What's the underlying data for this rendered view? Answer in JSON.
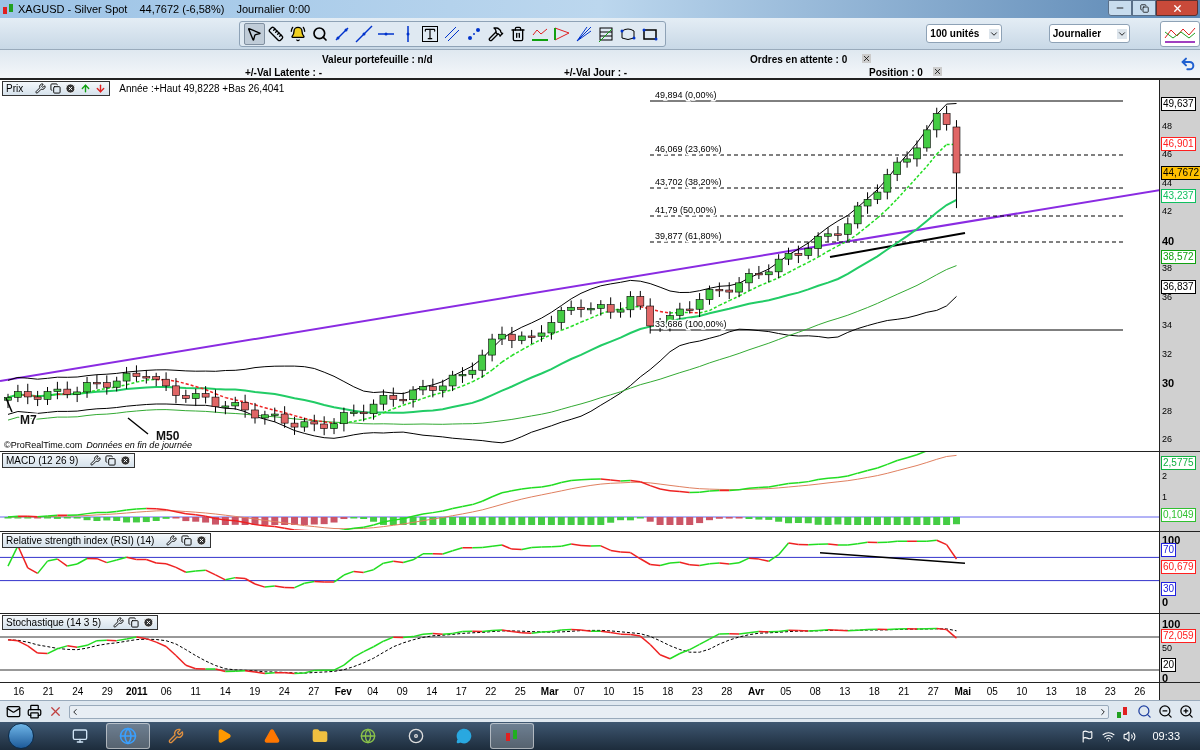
{
  "window": {
    "title": "XAGUSD - Silver Spot",
    "quote": "44,7672 (-6,58%)",
    "period": "Journalier",
    "time": "0:00"
  },
  "toolbar": {
    "tools": [
      {
        "kind": "pointer",
        "selected": true
      },
      {
        "kind": "ruler",
        "selected": false
      },
      {
        "kind": "alarm",
        "selected": false
      },
      {
        "kind": "zoom",
        "selected": false
      },
      {
        "kind": "segment",
        "selected": false
      },
      {
        "kind": "ray",
        "selected": false
      },
      {
        "kind": "hline",
        "selected": false
      },
      {
        "kind": "vline",
        "selected": false
      },
      {
        "kind": "text",
        "selected": false
      },
      {
        "kind": "parallel",
        "selected": false
      },
      {
        "kind": "points",
        "selected": false
      },
      {
        "kind": "tools",
        "selected": false
      },
      {
        "kind": "trash",
        "selected": false
      },
      {
        "kind": "fibonacci",
        "selected": false
      },
      {
        "kind": "fan",
        "selected": false
      },
      {
        "kind": "gann",
        "selected": false
      },
      {
        "kind": "grid",
        "selected": false
      },
      {
        "kind": "channel",
        "selected": false
      },
      {
        "kind": "rectangle",
        "selected": false
      }
    ],
    "quantity": "100 unités",
    "timeframe": "Journalier"
  },
  "portfolio": {
    "value": "Valeur portefeuille : n/d",
    "pending": "Ordres en attente : 0",
    "latent": "+/-Val Latente : -",
    "day": "+/-Val Jour : -",
    "position": "Position : 0"
  },
  "panes": [
    {
      "kind": "price",
      "title": "Prix",
      "info": "Année :+Haut 49,8228 +Bas 26,4041",
      "yticks": [
        {
          "label": "48",
          "bold": false
        },
        {
          "label": "46",
          "bold": false
        },
        {
          "label": "44",
          "bold": false
        },
        {
          "label": "42",
          "bold": false
        },
        {
          "label": "40",
          "bold": true
        },
        {
          "label": "38",
          "bold": false
        },
        {
          "label": "36",
          "bold": false
        },
        {
          "label": "34",
          "bold": false
        },
        {
          "label": "32",
          "bold": false
        },
        {
          "label": "30",
          "bold": true
        },
        {
          "label": "28",
          "bold": false
        },
        {
          "label": "26",
          "bold": false
        }
      ],
      "badges": [
        {
          "text": "49,637",
          "color": "#000000",
          "highlighted": false
        },
        {
          "text": "46,901",
          "color": "#ff2020",
          "highlighted": false
        },
        {
          "text": "44,7672",
          "color": "#000000",
          "highlighted": true
        },
        {
          "text": "43,237",
          "color": "#10c060",
          "highlighted": false
        },
        {
          "text": "38,572",
          "color": "#10a010",
          "highlighted": false
        },
        {
          "text": "36,837",
          "color": "#000000",
          "highlighted": false
        }
      ],
      "fib_levels": [
        "49,894 (0,00%)",
        "46,069 (23,60%)",
        "43,702 (38,20%)",
        "41,79 (50,00%)",
        "39,877 (61,80%)",
        "33,686 (100,00%)"
      ],
      "annotations": [
        "M7",
        "M50"
      ],
      "credit": "©ProRealTime.com",
      "credit_note": "Données en fin de journée"
    },
    {
      "kind": "macd",
      "title": "MACD (12 26 9)",
      "yticks": [
        {
          "label": "2",
          "bold": false
        },
        {
          "label": "1",
          "bold": false
        }
      ],
      "badges": [
        {
          "text": "2,5775",
          "color": "#10b040",
          "highlighted": false
        },
        {
          "text": "0,1049",
          "color": "#30c030",
          "highlighted": false
        }
      ]
    },
    {
      "kind": "rsi",
      "title": "Relative strength index (RSI) (14)",
      "yticks": [
        {
          "label": "100",
          "bold": true
        },
        {
          "label": "0",
          "bold": true
        }
      ],
      "badges": [
        {
          "text": "70",
          "color": "#2020e0",
          "highlighted": false
        },
        {
          "text": "60,679",
          "color": "#ff2020",
          "highlighted": false
        },
        {
          "text": "30",
          "color": "#2020e0",
          "highlighted": false
        }
      ]
    },
    {
      "kind": "stochastic",
      "title": "Stochastique (14 3 5)",
      "yticks": [
        {
          "label": "100",
          "bold": true
        },
        {
          "label": "50",
          "bold": false
        },
        {
          "label": "0",
          "bold": true
        }
      ],
      "badges": [
        {
          "text": "72,059",
          "color": "#ff2020",
          "highlighted": false
        },
        {
          "text": "20",
          "color": "#000000",
          "highlighted": false
        }
      ]
    }
  ],
  "date_axis": [
    {
      "label": "16",
      "bold": false
    },
    {
      "label": "21",
      "bold": false
    },
    {
      "label": "24",
      "bold": false
    },
    {
      "label": "29",
      "bold": false
    },
    {
      "label": "2011",
      "bold": true
    },
    {
      "label": "06",
      "bold": false
    },
    {
      "label": "11",
      "bold": false
    },
    {
      "label": "14",
      "bold": false
    },
    {
      "label": "19",
      "bold": false
    },
    {
      "label": "24",
      "bold": false
    },
    {
      "label": "27",
      "bold": false
    },
    {
      "label": "Fev",
      "bold": true
    },
    {
      "label": "04",
      "bold": false
    },
    {
      "label": "09",
      "bold": false
    },
    {
      "label": "14",
      "bold": false
    },
    {
      "label": "17",
      "bold": false
    },
    {
      "label": "22",
      "bold": false
    },
    {
      "label": "25",
      "bold": false
    },
    {
      "label": "Mar",
      "bold": true
    },
    {
      "label": "07",
      "bold": false
    },
    {
      "label": "10",
      "bold": false
    },
    {
      "label": "15",
      "bold": false
    },
    {
      "label": "18",
      "bold": false
    },
    {
      "label": "23",
      "bold": false
    },
    {
      "label": "28",
      "bold": false
    },
    {
      "label": "Avr",
      "bold": true
    },
    {
      "label": "05",
      "bold": false
    },
    {
      "label": "08",
      "bold": false
    },
    {
      "label": "13",
      "bold": false
    },
    {
      "label": "18",
      "bold": false
    },
    {
      "label": "21",
      "bold": false
    },
    {
      "label": "27",
      "bold": false
    },
    {
      "label": "Mai",
      "bold": true
    },
    {
      "label": "05",
      "bold": false
    },
    {
      "label": "10",
      "bold": false
    },
    {
      "label": "13",
      "bold": false
    },
    {
      "label": "18",
      "bold": false
    },
    {
      "label": "23",
      "bold": false
    },
    {
      "label": "26",
      "bold": false
    }
  ],
  "taskbar": {
    "apps": [
      {
        "kind": "window",
        "selected": false
      },
      {
        "kind": "browser",
        "selected": true
      },
      {
        "kind": "tool",
        "selected": false
      },
      {
        "kind": "media",
        "selected": false
      },
      {
        "kind": "cone",
        "selected": false
      },
      {
        "kind": "folder",
        "selected": false
      },
      {
        "kind": "globe",
        "selected": false
      },
      {
        "kind": "disc",
        "selected": false
      },
      {
        "kind": "chat",
        "selected": false
      },
      {
        "kind": "chart",
        "selected": true
      }
    ],
    "clock": "09:33"
  }
}
